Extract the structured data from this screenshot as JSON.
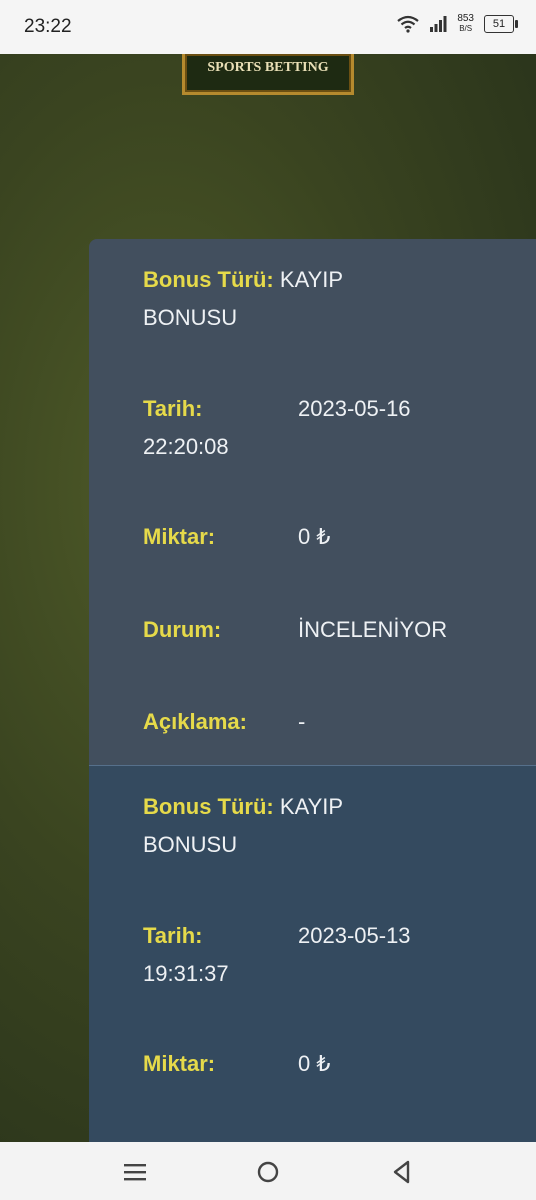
{
  "status": {
    "time": "23:22",
    "net_speed_value": "853",
    "net_speed_unit": "B/S",
    "battery": "51"
  },
  "logo": {
    "text": "SPORTS BETTING"
  },
  "records": [
    {
      "bonus_label": "Bonus Türü:",
      "bonus_value_1": "KAYIP",
      "bonus_value_2": "BONUSU",
      "date_label": "Tarih:",
      "date_value": "2023-05-16",
      "time_value": "22:20:08",
      "amount_label": "Miktar:",
      "amount_value": "0 ₺",
      "status_label": "Durum:",
      "status_value": "İNCELENİYOR",
      "desc_label": "Açıklama:",
      "desc_value": "-"
    },
    {
      "bonus_label": "Bonus Türü:",
      "bonus_value_1": "KAYIP",
      "bonus_value_2": "BONUSU",
      "date_label": "Tarih:",
      "date_value": "2023-05-13",
      "time_value": "19:31:37",
      "amount_label": "Miktar:",
      "amount_value": "0 ₺"
    }
  ]
}
